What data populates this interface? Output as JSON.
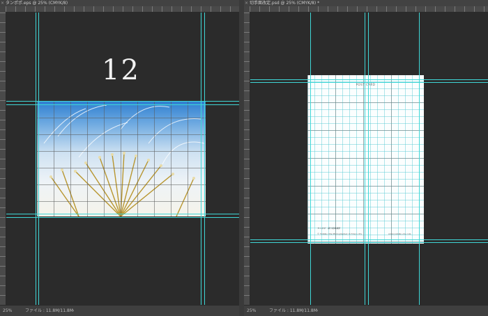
{
  "colors": {
    "guide": "#3fd7d7",
    "canvas": "#2b2b2b",
    "panel": "#535353"
  },
  "left_doc": {
    "tab_title": "タンポポ.eps @ 25% (CMYK/8)",
    "close_icon": "close-icon",
    "number_label": "12",
    "status_zoom": "25%",
    "status_file": "ファイル : 11.8M/11.8M",
    "status_arrow": "›"
  },
  "right_doc": {
    "tab_title": "切手面改定.psd @ 25% (CMYK/8) *",
    "close_icon": "close-icon",
    "postcard_title": "POST CARD",
    "postcard_caption": "タンポポ　撮り鉛筆撮影",
    "postcard_copyright": "© Yumiko Ota Photographer, in Tokyo city",
    "postcard_url": "www.yumiko-ota.com",
    "status_zoom": "25%",
    "status_file": "ファイル : 11.8M/11.8M",
    "status_arrow": "›"
  }
}
